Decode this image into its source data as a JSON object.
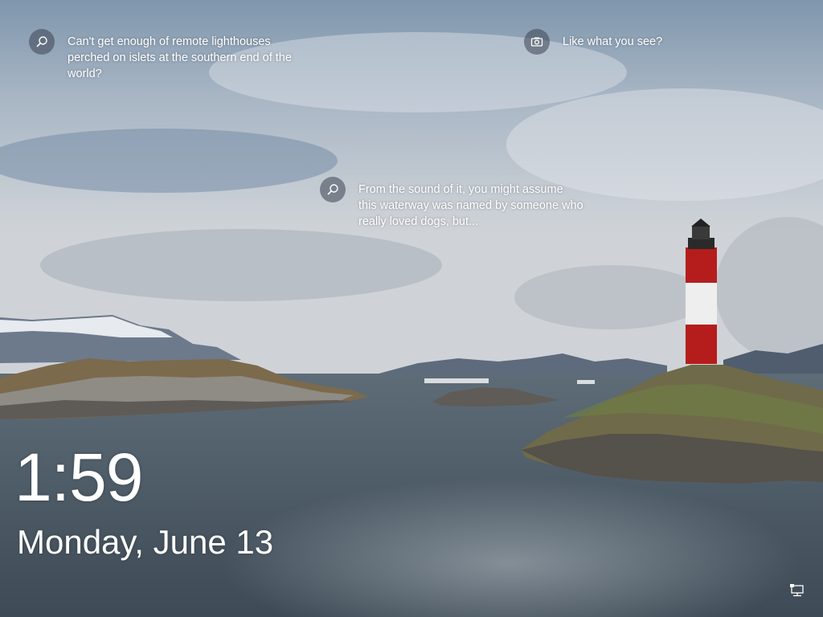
{
  "lockscreen": {
    "hotspots": [
      {
        "icon": "search-icon",
        "text": "Can't get enough of remote lighthouses perched on islets at the southern end of the world?"
      },
      {
        "icon": "camera-icon",
        "text": "Like what you see?"
      },
      {
        "icon": "search-icon",
        "text": "From the sound of it, you might assume this waterway was named by someone who really loved dogs, but..."
      }
    ],
    "time": "1:59",
    "date": "Monday, June 13",
    "tray_icon": "network-icon"
  }
}
